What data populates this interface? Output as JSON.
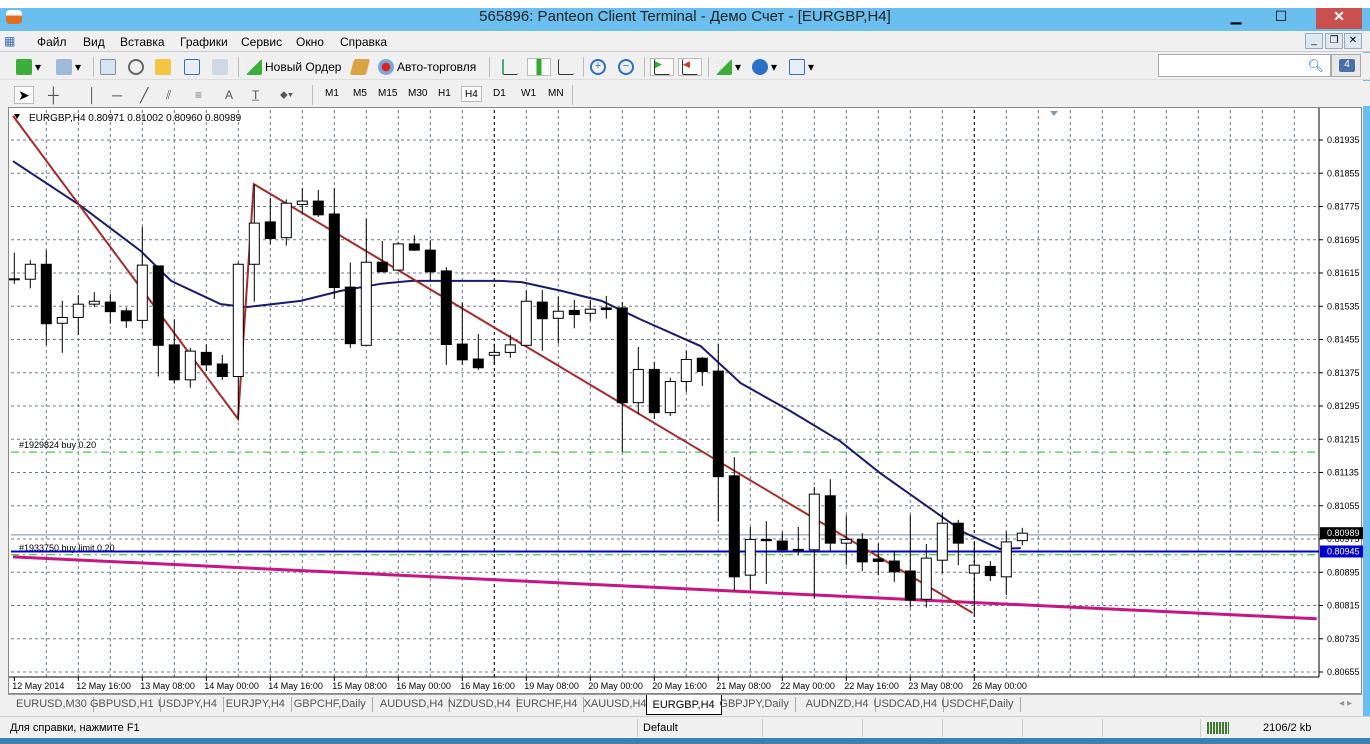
{
  "window": {
    "title": "565896: Panteon Client Terminal - Демо Счет - [EURGBP,H4]",
    "minimize": "▁",
    "maximize": "☐",
    "close": "✕"
  },
  "menu": [
    "Файл",
    "Вид",
    "Вставка",
    "Графики",
    "Сервис",
    "Окно",
    "Справка"
  ],
  "mdi_buttons": [
    "_",
    "❐",
    "✕"
  ],
  "toolbar": {
    "new_order": "Новый Ордер",
    "auto_trading": "Авто-торговля"
  },
  "timeframes": [
    "M1",
    "M5",
    "M15",
    "M30",
    "H1",
    "H4",
    "D1",
    "W1",
    "MN"
  ],
  "active_timeframe": "H4",
  "search": {
    "placeholder": "",
    "notifications": "4"
  },
  "chart_data": {
    "type": "candlestick",
    "symbol_header": "EURGBP,H4  0.80971 0.81002 0.80960 0.80989",
    "ylim": [
      0.80625,
      0.8201
    ],
    "price_ticks": [
      "0.81935",
      "0.81855",
      "0.81775",
      "0.81695",
      "0.81615",
      "0.81535",
      "0.81455",
      "0.81375",
      "0.81295",
      "0.81215",
      "0.81135",
      "0.81055",
      "0.80975",
      "0.80895",
      "0.80815",
      "0.80735",
      "0.80655"
    ],
    "bid_label": "0.80989",
    "order_price_label": "0.80945",
    "time_labels": [
      "12 May 2014",
      "12 May 16:00",
      "13 May 08:00",
      "14 May 00:00",
      "14 May 16:00",
      "15 May 08:00",
      "16 May 00:00",
      "16 May 16:00",
      "19 May 08:00",
      "20 May 00:00",
      "20 May 16:00",
      "21 May 08:00",
      "22 May 00:00",
      "22 May 16:00",
      "23 May 08:00",
      "26 May 00:00"
    ],
    "ohlc": [
      [
        0.81601,
        0.81664,
        0.81589,
        0.816
      ],
      [
        0.816,
        0.81646,
        0.81578,
        0.81636
      ],
      [
        0.81636,
        0.8167,
        0.81442,
        0.81493
      ],
      [
        0.81494,
        0.81548,
        0.81423,
        0.81508
      ],
      [
        0.81508,
        0.81562,
        0.81466,
        0.8154
      ],
      [
        0.8154,
        0.81569,
        0.81533,
        0.81547
      ],
      [
        0.81545,
        0.81565,
        0.81493,
        0.81522
      ],
      [
        0.81524,
        0.81532,
        0.81483,
        0.815
      ],
      [
        0.81501,
        0.81726,
        0.81483,
        0.81634
      ],
      [
        0.81632,
        0.81632,
        0.81366,
        0.81441
      ],
      [
        0.81442,
        0.81504,
        0.81349,
        0.81358
      ],
      [
        0.81358,
        0.81435,
        0.81339,
        0.81427
      ],
      [
        0.81424,
        0.81443,
        0.81379,
        0.81394
      ],
      [
        0.81396,
        0.81418,
        0.81358,
        0.81366
      ],
      [
        0.81366,
        0.81641,
        0.81263,
        0.81636
      ],
      [
        0.81636,
        0.81828,
        0.81546,
        0.81735
      ],
      [
        0.81738,
        0.81796,
        0.81684,
        0.81698
      ],
      [
        0.817,
        0.81792,
        0.81681,
        0.81783
      ],
      [
        0.8178,
        0.81819,
        0.81758,
        0.81788
      ],
      [
        0.81788,
        0.81815,
        0.8175,
        0.81755
      ],
      [
        0.81757,
        0.81819,
        0.81553,
        0.8158
      ],
      [
        0.81581,
        0.8164,
        0.81435,
        0.81445
      ],
      [
        0.81441,
        0.81746,
        0.81441,
        0.81641
      ],
      [
        0.81641,
        0.81692,
        0.81618,
        0.81618
      ],
      [
        0.81622,
        0.8169,
        0.81622,
        0.81685
      ],
      [
        0.81685,
        0.81706,
        0.81668,
        0.8167
      ],
      [
        0.8167,
        0.81694,
        0.81597,
        0.81618
      ],
      [
        0.8162,
        0.81629,
        0.81394,
        0.81443
      ],
      [
        0.81444,
        0.81544,
        0.81394,
        0.81406
      ],
      [
        0.81408,
        0.81468,
        0.81382,
        0.81387
      ],
      [
        0.81417,
        0.81445,
        0.81394,
        0.81424
      ],
      [
        0.81424,
        0.81466,
        0.81411,
        0.81442
      ],
      [
        0.81441,
        0.81573,
        0.81441,
        0.81547
      ],
      [
        0.81545,
        0.81574,
        0.81428,
        0.81505
      ],
      [
        0.81506,
        0.81558,
        0.81445,
        0.81523
      ],
      [
        0.81525,
        0.8155,
        0.81482,
        0.81515
      ],
      [
        0.81518,
        0.8155,
        0.815,
        0.81528
      ],
      [
        0.81531,
        0.8156,
        0.81505,
        0.81527
      ],
      [
        0.81531,
        0.81545,
        0.81184,
        0.81303
      ],
      [
        0.81303,
        0.81437,
        0.81275,
        0.81383
      ],
      [
        0.81383,
        0.81401,
        0.81264,
        0.81279
      ],
      [
        0.81279,
        0.81363,
        0.81271,
        0.81354
      ],
      [
        0.81354,
        0.81428,
        0.81329,
        0.81407
      ],
      [
        0.8141,
        0.81413,
        0.81343,
        0.81378
      ],
      [
        0.81379,
        0.81445,
        0.81017,
        0.81125
      ],
      [
        0.81127,
        0.81172,
        0.8085,
        0.80884
      ],
      [
        0.80888,
        0.81004,
        0.80852,
        0.80974
      ],
      [
        0.80974,
        0.81018,
        0.80867,
        0.80971
      ],
      [
        0.8097,
        0.80992,
        0.80942,
        0.80949
      ],
      [
        0.8095,
        0.81004,
        0.80936,
        0.80947
      ],
      [
        0.80949,
        0.811,
        0.80832,
        0.81083
      ],
      [
        0.81079,
        0.81119,
        0.80946,
        0.80965
      ],
      [
        0.80965,
        0.81032,
        0.80912,
        0.80974
      ],
      [
        0.80974,
        0.80989,
        0.80898,
        0.8092
      ],
      [
        0.80927,
        0.80964,
        0.80888,
        0.80921
      ],
      [
        0.80922,
        0.80946,
        0.80872,
        0.80896
      ],
      [
        0.80898,
        0.81033,
        0.8081,
        0.80828
      ],
      [
        0.8083,
        0.80963,
        0.8081,
        0.80929
      ],
      [
        0.80924,
        0.81038,
        0.80893,
        0.81013
      ],
      [
        0.81013,
        0.81021,
        0.80912,
        0.80965
      ],
      [
        0.80893,
        0.8097,
        0.80794,
        0.80912
      ],
      [
        0.80909,
        0.80922,
        0.80874,
        0.80887
      ],
      [
        0.80884,
        0.80993,
        0.8084,
        0.80968
      ],
      [
        0.80971,
        0.81002,
        0.8096,
        0.80989
      ]
    ],
    "moving_average": [
      [
        0.92,
        0.81884
      ],
      [
        5.17,
        0.81776
      ],
      [
        8.9,
        0.81668
      ],
      [
        10.8,
        0.81596
      ],
      [
        13.9,
        0.8154
      ],
      [
        15.5,
        0.81533
      ],
      [
        18.9,
        0.81548
      ],
      [
        21.4,
        0.81572
      ],
      [
        23.9,
        0.81589
      ],
      [
        25.8,
        0.81596
      ],
      [
        31.4,
        0.81596
      ],
      [
        32.7,
        0.81593
      ],
      [
        35.2,
        0.81572
      ],
      [
        37.7,
        0.81548
      ],
      [
        40.1,
        0.81504
      ],
      [
        43.9,
        0.81439
      ],
      [
        46.4,
        0.8135
      ],
      [
        49.5,
        0.81283
      ],
      [
        52.6,
        0.81211
      ],
      [
        55.1,
        0.81134
      ],
      [
        57.6,
        0.81066
      ],
      [
        60.4,
        0.8099
      ],
      [
        62.6,
        0.80951
      ],
      [
        63.9,
        0.80953
      ]
    ],
    "zigzag": [
      [
        0.92,
        0.81993
      ],
      [
        14.98,
        0.81264
      ],
      [
        15.97,
        0.81829
      ],
      [
        60.9,
        0.80797
      ]
    ],
    "trendline": [
      [
        0.92,
        0.80932
      ],
      [
        82.4,
        0.80783
      ]
    ],
    "orders": [
      {
        "label": "#1929824 buy 0.20",
        "price": 0.81184
      },
      {
        "label": "#1933750 buy limit 0.20",
        "price": 0.80937
      }
    ],
    "order_line_price": 0.80945,
    "bid_price": 0.80985,
    "period_separators": [
      31,
      61
    ]
  },
  "symbol_tabs": [
    "EURUSD,M30",
    "GBPUSD,H1",
    "USDJPY,H4",
    "EURJPY,H4",
    "GBPCHF,Daily",
    "AUDUSD,H4",
    "NZDUSD,H4",
    "EURCHF,H4",
    "XAUUSD,H4",
    "EURGBP,H4",
    "GBPJPY,Daily",
    "AUDNZD,H4",
    "USDCAD,H4",
    "USDCHF,Daily"
  ],
  "active_tab": "EURGBP,H4",
  "status": {
    "help": "Для справки, нажмите F1",
    "profile": "Default",
    "traffic": "2106/2 kb"
  },
  "colors": {
    "ma": "#1a1a6e",
    "zigzag": "#a52a2a",
    "trendline": "#c71585",
    "order_line": "#0000cc",
    "order_dash": "#22bb22",
    "grid": "#6b7b8c",
    "title_bar": "#6bbfef"
  }
}
